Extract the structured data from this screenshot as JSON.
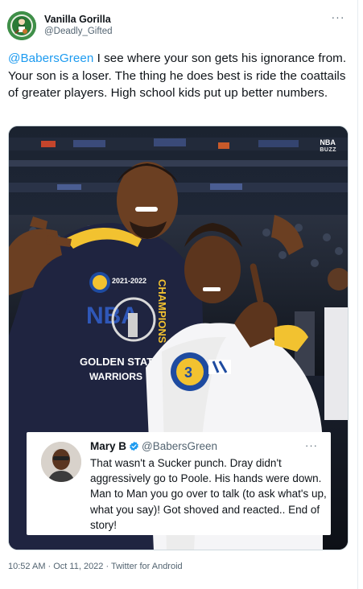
{
  "tweet": {
    "author": {
      "display_name": "Vanilla Gorilla",
      "handle": "@Deadly_Gifted",
      "avatar_icon": "celtics-logo-avatar"
    },
    "more_icon": "more-options-icon",
    "text": {
      "mention": "@BabersGreen",
      "body": " I see where your son gets his ignorance from. Your son is a loser. The thing he does best is ride the coattails of greater players. High school kids put up better numbers."
    },
    "media": {
      "watermark_top": "NBA",
      "watermark_bottom": "BUZZ",
      "shirt_text": {
        "season": "2021-2022",
        "nba": "NBA",
        "team": "GOLDEN STATE",
        "warriors": "WARRIORS",
        "champs": "CHAMPIONS",
        "jersey_number": "3"
      }
    },
    "quoted_tweet": {
      "display_name": "Mary B",
      "handle": "@BabersGreen",
      "verified_icon": "verified-badge-icon",
      "text": "That wasn't a Sucker punch. Dray didn't aggressively go to Poole. His hands were down. Man to Man you go over to talk (to ask what's up, what you say)! Got shoved and reacted.. End of story!"
    },
    "meta": "10:52 AM · Oct 11, 2022 · Twitter for Android"
  },
  "colors": {
    "link": "#1d9bf0",
    "secondary_text": "#536471",
    "primary_text": "#0f1419"
  }
}
